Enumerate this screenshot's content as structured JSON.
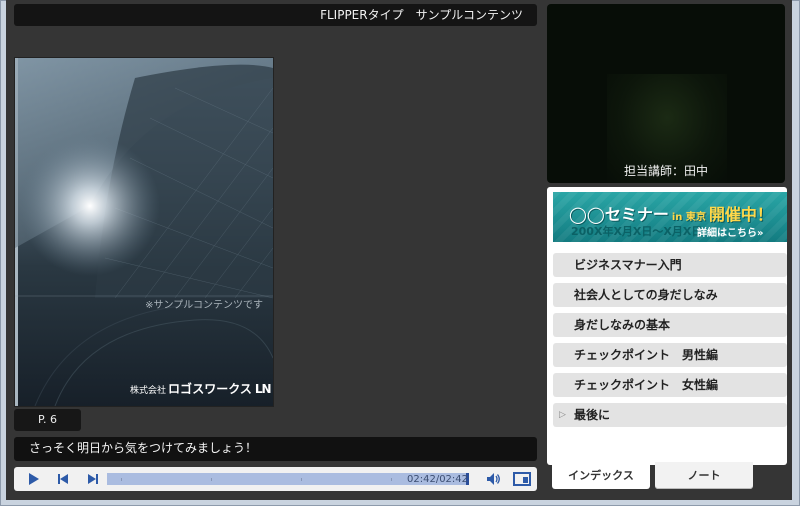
{
  "title_bar": {
    "text": "FLIPPERタイプ　サンプルコンテンツ"
  },
  "book": {
    "note": "※サンプルコンテンツです",
    "logo_company_prefix": "株式会社",
    "logo_name": "ロゴスワークス",
    "logo_mark": "LN"
  },
  "page_badge": {
    "label": "P. 6"
  },
  "caption": {
    "text": "さっそく明日から気をつけてみましょう！"
  },
  "player": {
    "time": "02:42/02:42",
    "progress": 1.0,
    "icons": [
      "play-icon",
      "previous-icon",
      "next-icon",
      "volume-icon",
      "layout-toggle-icon"
    ]
  },
  "video": {
    "instructor": "担当講師：田中"
  },
  "banner": {
    "title_prefix": "◯◯セミナー",
    "title_location": "in 東京",
    "title_status": "開催中！",
    "dates": "200X年X月X日～X月X日",
    "link": "詳細はこちら»"
  },
  "index": {
    "items": [
      {
        "label": "ビジネスマナー入門"
      },
      {
        "label": "社会人としての身だしなみ"
      },
      {
        "label": "身だしなみの基本"
      },
      {
        "label": "チェックポイント　男性編"
      },
      {
        "label": "チェックポイント　女性編"
      },
      {
        "label": "最後に",
        "marker": "▷"
      }
    ]
  },
  "tabs": {
    "index": "インデックス",
    "note": "ノート",
    "active": "index"
  },
  "colors": {
    "stage": "#353535",
    "accent_seek": "#b8c6e0",
    "banner": "#1d8f92",
    "banner_highlight": "#ffd84a"
  }
}
